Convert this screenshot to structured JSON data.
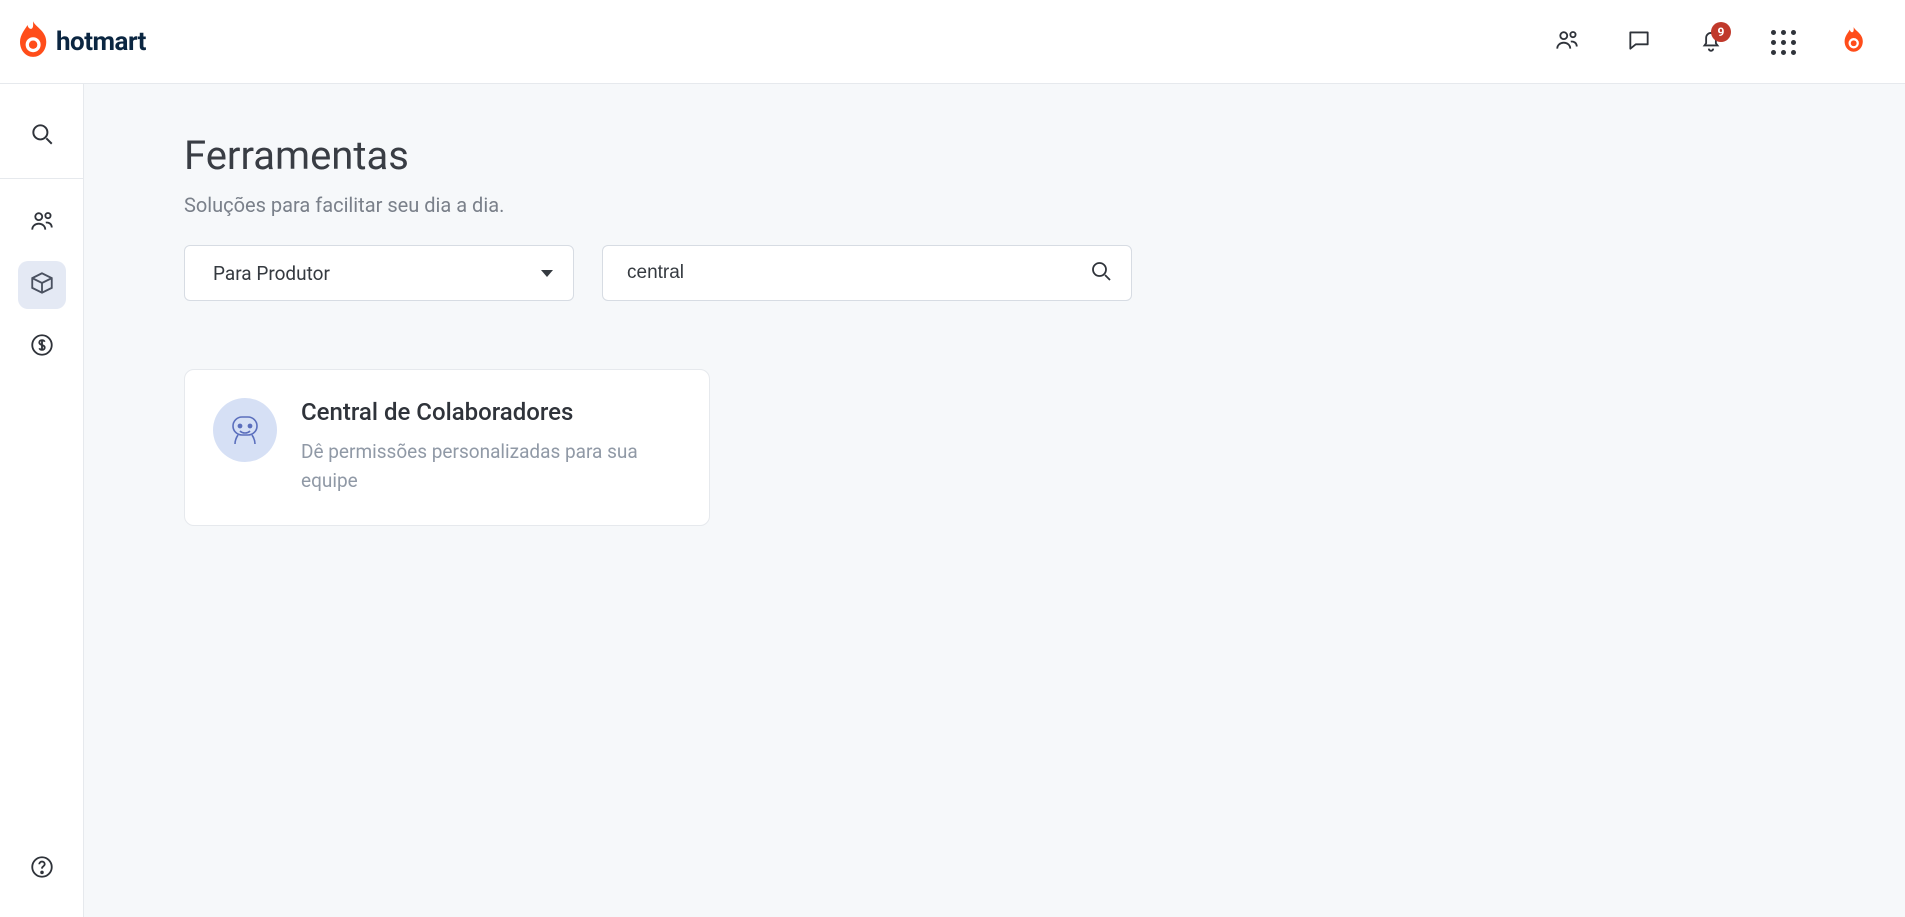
{
  "brand": {
    "name": "hotmart"
  },
  "header": {
    "notification_count": "9"
  },
  "main": {
    "title": "Ferramentas",
    "subtitle": "Soluções para facilitar seu dia a dia.",
    "filter_select_label": "Para Produtor",
    "search_value": "central"
  },
  "results": [
    {
      "title": "Central de Colaboradores",
      "description": "Dê permissões personalizadas para sua equipe"
    }
  ]
}
